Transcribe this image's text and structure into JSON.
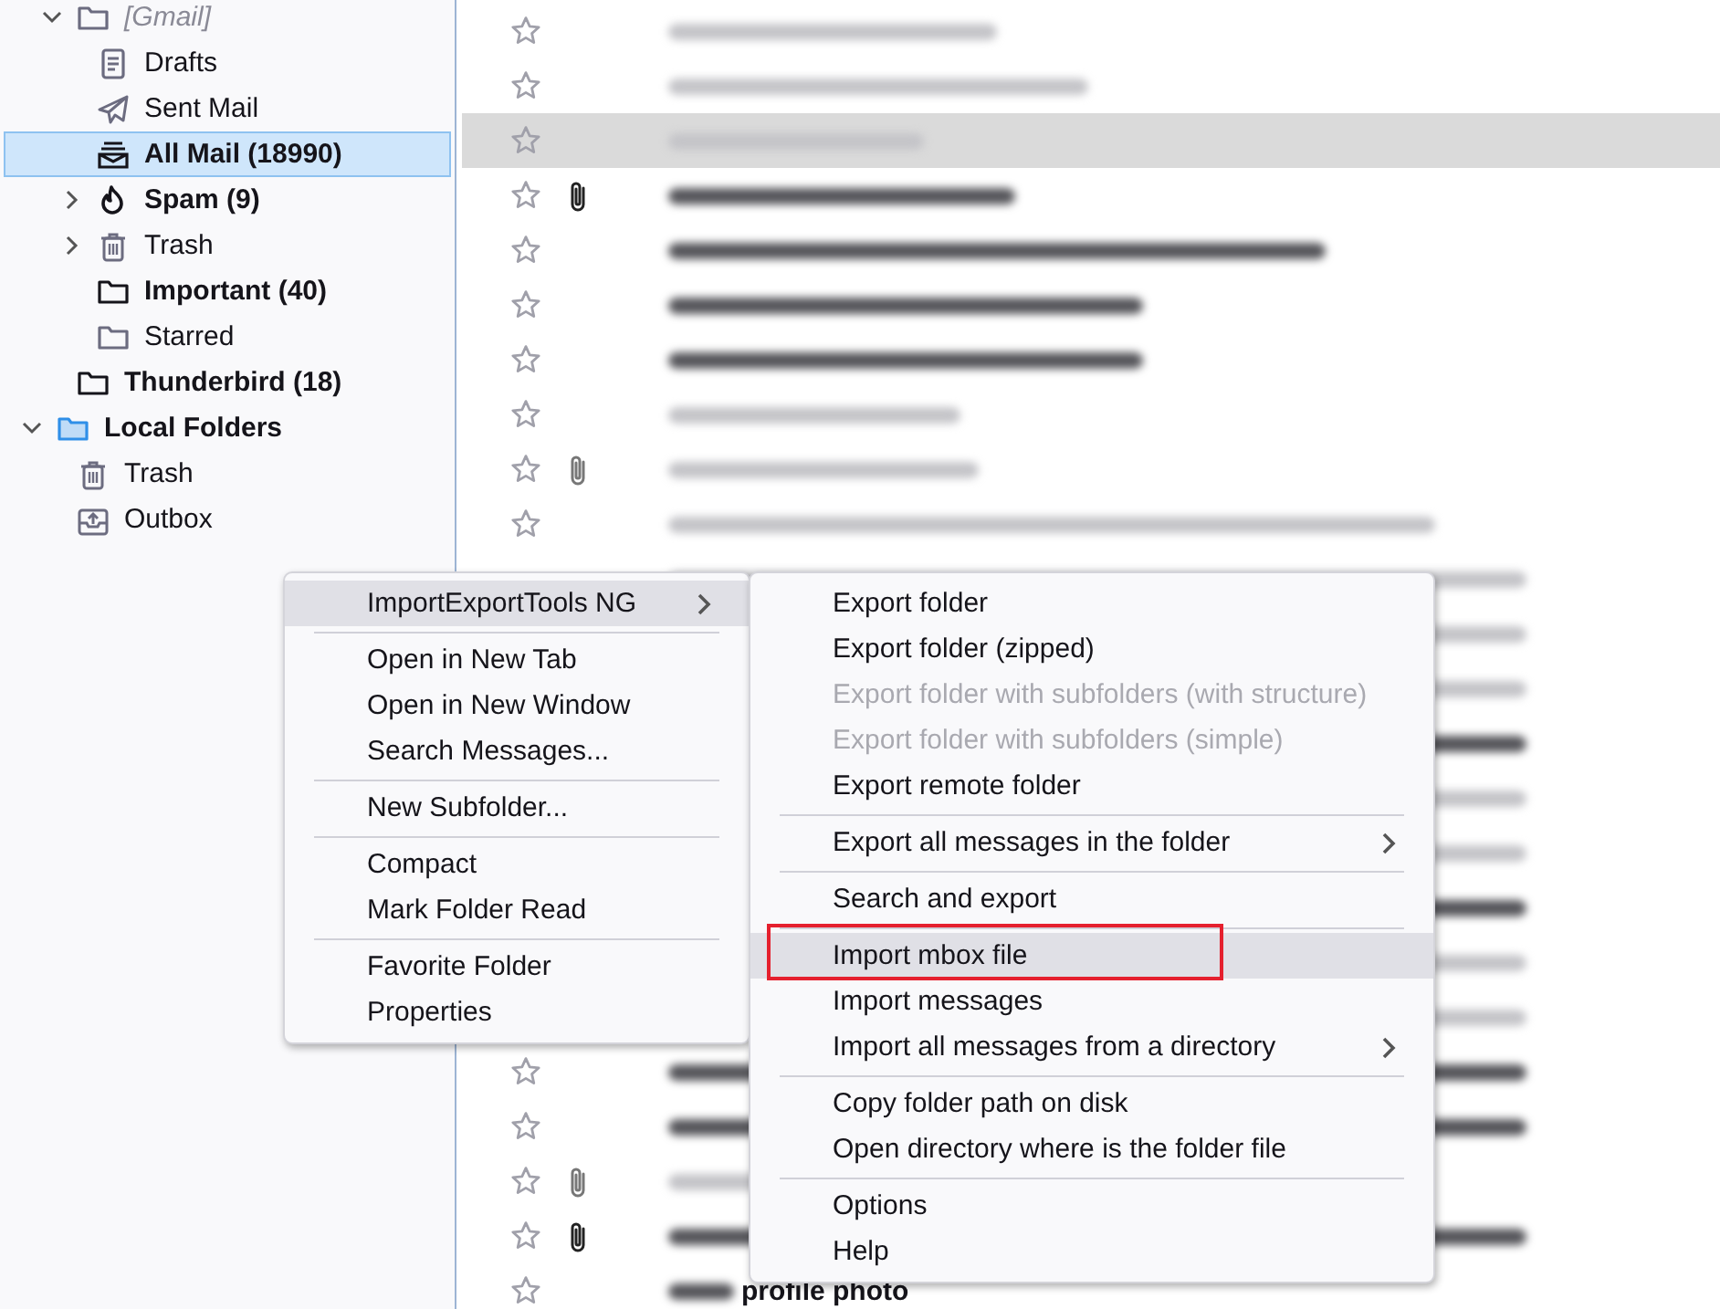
{
  "folder_tree": [
    {
      "label": "[Gmail]",
      "kind": "folder",
      "italic": true,
      "bold": false,
      "selected": false,
      "expanded": true,
      "children": [
        {
          "label": "Drafts",
          "kind": "drafts",
          "bold": false,
          "selected": false
        },
        {
          "label": "Sent Mail",
          "kind": "sent",
          "bold": false,
          "selected": false
        },
        {
          "label": "All Mail (18990)",
          "kind": "archive",
          "bold": true,
          "selected": true
        },
        {
          "label": "Spam (9)",
          "kind": "spam",
          "bold": true,
          "selected": false,
          "expanded": false
        },
        {
          "label": "Trash",
          "kind": "trash",
          "bold": false,
          "selected": false,
          "expanded": false
        },
        {
          "label": "Important (40)",
          "kind": "folder",
          "bold": true,
          "selected": false
        },
        {
          "label": "Starred",
          "kind": "folder",
          "bold": false,
          "selected": false
        }
      ]
    },
    {
      "label": "Thunderbird (18)",
      "kind": "folder",
      "bold": true,
      "selected": false
    }
  ],
  "local_tree": [
    {
      "label": "Local Folders",
      "kind": "local",
      "bold": true,
      "selected": false,
      "expanded": true,
      "children": [
        {
          "label": "Trash",
          "kind": "trash",
          "bold": false,
          "selected": false
        },
        {
          "label": "Outbox",
          "kind": "outbox",
          "bold": false,
          "selected": false
        }
      ]
    }
  ],
  "messages": [
    {
      "unread": false,
      "attachment": false,
      "selected": false
    },
    {
      "unread": false,
      "attachment": false,
      "selected": false
    },
    {
      "unread": false,
      "attachment": false,
      "selected": true
    },
    {
      "unread": true,
      "attachment": true,
      "selected": false
    },
    {
      "unread": true,
      "attachment": false,
      "selected": false
    },
    {
      "unread": true,
      "attachment": false,
      "selected": false
    },
    {
      "unread": true,
      "attachment": false,
      "selected": false
    },
    {
      "unread": false,
      "attachment": false,
      "selected": false
    },
    {
      "unread": false,
      "attachment": true,
      "selected": false
    },
    {
      "unread": false,
      "attachment": false,
      "selected": false
    },
    {
      "unread": false
    },
    {
      "unread": false
    },
    {
      "unread": false
    },
    {
      "unread": true
    },
    {
      "unread": false
    },
    {
      "unread": false
    },
    {
      "unread": true
    },
    {
      "unread": false
    },
    {
      "unread": false
    },
    {
      "unread": true,
      "attachment": false,
      "selected": false
    },
    {
      "unread": true,
      "attachment": false,
      "selected": false
    },
    {
      "unread": false,
      "attachment": true,
      "selected": false
    },
    {
      "unread": true,
      "attachment": true,
      "selected": false
    },
    {
      "unread": true,
      "attachment": false,
      "selected": false,
      "subject_tail": "profile photo"
    }
  ],
  "context_menu": {
    "groups": [
      [
        {
          "label": "ImportExportTools NG",
          "submenu": true,
          "selected": true
        }
      ],
      [
        {
          "label": "Open in New Tab",
          "selected": false
        },
        {
          "label": "Open in New Window",
          "selected": false
        },
        {
          "label": "Search Messages...",
          "selected": false
        }
      ],
      [
        {
          "label": "New Subfolder...",
          "selected": false
        }
      ],
      [
        {
          "label": "Compact",
          "selected": false
        },
        {
          "label": "Mark Folder Read",
          "selected": false
        }
      ],
      [
        {
          "label": "Favorite Folder",
          "selected": false
        },
        {
          "label": "Properties",
          "selected": false
        }
      ]
    ]
  },
  "submenu": {
    "groups": [
      [
        {
          "label": "Export folder",
          "disabled": false
        },
        {
          "label": "Export folder (zipped)",
          "disabled": false
        },
        {
          "label": "Export folder with subfolders (with structure)",
          "disabled": true
        },
        {
          "label": "Export folder with subfolders (simple)",
          "disabled": true
        },
        {
          "label": "Export remote folder",
          "disabled": false
        }
      ],
      [
        {
          "label": "Export all messages in the folder",
          "submenu": true,
          "disabled": false
        }
      ],
      [
        {
          "label": "Search and export",
          "disabled": false
        }
      ],
      [
        {
          "label": "Import mbox file",
          "selected": true,
          "highlighted": true,
          "disabled": false
        },
        {
          "label": "Import messages",
          "disabled": false
        },
        {
          "label": "Import all messages from a directory",
          "submenu": true,
          "disabled": false
        }
      ],
      [
        {
          "label": "Copy folder path on disk",
          "disabled": false
        },
        {
          "label": "Open directory where is the folder file",
          "disabled": false
        }
      ],
      [
        {
          "label": "Options",
          "disabled": false
        },
        {
          "label": "Help",
          "disabled": false
        }
      ]
    ]
  }
}
